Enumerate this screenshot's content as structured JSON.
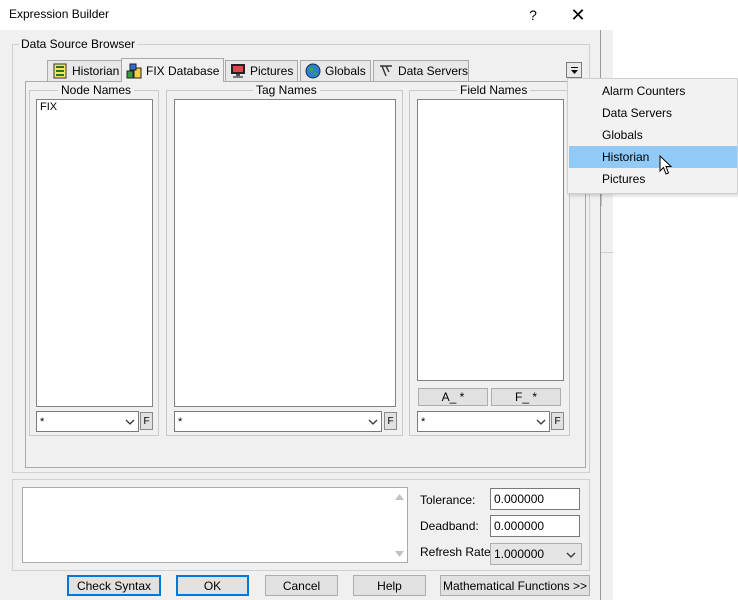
{
  "window": {
    "title": "Expression Builder",
    "help_glyph": "?",
    "close_glyph": "✕"
  },
  "group": {
    "label": "Data Source Browser"
  },
  "tabs": [
    {
      "label": "Historian",
      "icon": "historian-icon"
    },
    {
      "label": "FIX Database",
      "icon": "fix-database-icon",
      "active": true
    },
    {
      "label": "Pictures",
      "icon": "pictures-icon"
    },
    {
      "label": "Globals",
      "icon": "globe-icon"
    },
    {
      "label": "Data Servers",
      "icon": "data-servers-icon"
    }
  ],
  "node_names": {
    "label": "Node Names",
    "items": [
      "FIX"
    ],
    "filter": "*",
    "f_label": "F"
  },
  "tag_names": {
    "label": "Tag Names",
    "filter": "*",
    "f_label": "F"
  },
  "field_names": {
    "label": "Field Names",
    "a_button": "A_ *",
    "f_button": "F_ *",
    "filter": "*",
    "f_label": "F"
  },
  "params": {
    "tolerance_label": "Tolerance:",
    "tolerance_value": "0.000000",
    "deadband_label": "Deadband:",
    "deadband_value": "0.000000",
    "refresh_label": "Refresh Rate:",
    "refresh_value": "1.000000"
  },
  "buttons": {
    "check_syntax": "Check Syntax",
    "ok": "OK",
    "cancel": "Cancel",
    "help": "Help",
    "math_functions": "Mathematical Functions >>"
  },
  "dropdown_menu": {
    "items": [
      "Alarm Counters",
      "Data Servers",
      "Globals",
      "Historian",
      "Pictures"
    ],
    "highlighted": "Historian",
    "highlight_color": "#91c9f7"
  }
}
